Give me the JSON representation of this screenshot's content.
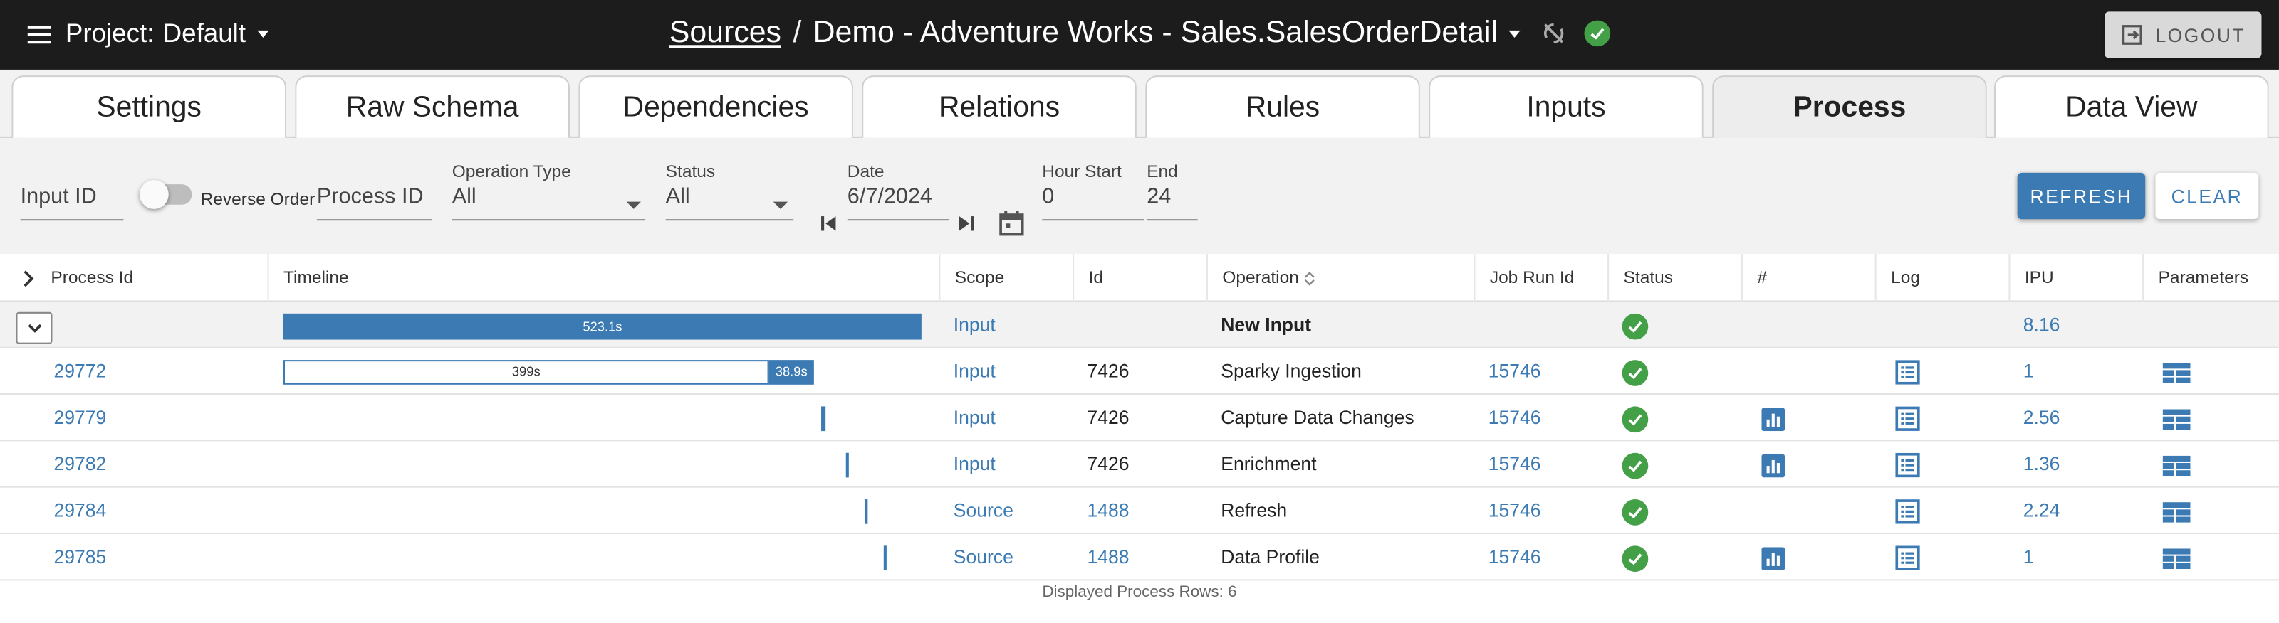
{
  "header": {
    "project_label": "Project:",
    "project_value": "Default",
    "breadcrumb_link": "Sources",
    "breadcrumb_sep": "/",
    "breadcrumb_current": "Demo - Adventure Works - Sales.SalesOrderDetail",
    "logout_label": "LOGOUT"
  },
  "tabs": [
    {
      "label": "Settings"
    },
    {
      "label": "Raw Schema"
    },
    {
      "label": "Dependencies"
    },
    {
      "label": "Relations"
    },
    {
      "label": "Rules"
    },
    {
      "label": "Inputs"
    },
    {
      "label": "Process",
      "active": true
    },
    {
      "label": "Data View"
    }
  ],
  "filters": {
    "input_id_placeholder": "Input ID",
    "reverse_order_label": "Reverse Order",
    "process_id_placeholder": "Process ID",
    "operation_type_label": "Operation Type",
    "operation_type_value": "All",
    "status_label": "Status",
    "status_value": "All",
    "date_label": "Date",
    "date_value": "6/7/2024",
    "hour_start_label": "Hour Start",
    "hour_start_value": "0",
    "end_label": "End",
    "end_value": "24",
    "refresh_label": "REFRESH",
    "clear_label": "CLEAR"
  },
  "table": {
    "columns": [
      "Process Id",
      "Timeline",
      "Scope",
      "Id",
      "Operation",
      "Job Run Id",
      "Status",
      "#",
      "Log",
      "IPU",
      "Parameters"
    ],
    "group": {
      "timeline_label": "523.1s",
      "scope": "Input",
      "operation": "New Input",
      "ipu": "8.16"
    },
    "rows": [
      {
        "process_id": "29772",
        "scope": "Input",
        "id": "7426",
        "operation": "Sparky Ingestion",
        "job_run_id": "15746",
        "has_stats": false,
        "ipu": "1",
        "timeline": {
          "label_a": "399s",
          "label_b": "38.9s"
        }
      },
      {
        "process_id": "29779",
        "scope": "Input",
        "id": "7426",
        "operation": "Capture Data Changes",
        "job_run_id": "15746",
        "has_stats": true,
        "ipu": "2.56"
      },
      {
        "process_id": "29782",
        "scope": "Input",
        "id": "7426",
        "operation": "Enrichment",
        "job_run_id": "15746",
        "has_stats": true,
        "ipu": "1.36"
      },
      {
        "process_id": "29784",
        "scope": "Source",
        "id": "1488",
        "operation": "Refresh",
        "job_run_id": "15746",
        "has_stats": false,
        "ipu": "2.24"
      },
      {
        "process_id": "29785",
        "scope": "Source",
        "id": "1488",
        "operation": "Data Profile",
        "job_run_id": "15746",
        "has_stats": true,
        "ipu": "1"
      }
    ]
  },
  "footer": {
    "text": "Displayed Process Rows: 6"
  }
}
